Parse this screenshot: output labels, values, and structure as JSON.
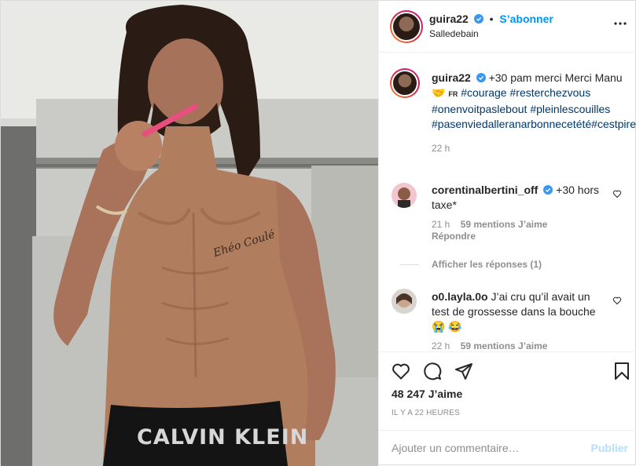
{
  "post": {
    "author": "guira22",
    "follow_label": "S’abonner",
    "location": "Salledebain",
    "separator": "•",
    "photo_brand_text": "CALVIN KLEIN",
    "photo_tattoo_text": "Ehéo Coulé"
  },
  "caption": {
    "author": "guira22",
    "text_before": "+30 pam merci Merci Manu",
    "emoji": "🤝",
    "flag": "FR",
    "hashtags": [
      "#courage",
      "#resterchezvous",
      "#onenvoitpaslebout",
      "#pleinlescouilles",
      "#pasenviedalleranarbonnecetété",
      "#cestpirequelemitarcettehistoire."
    ],
    "time": "22 h"
  },
  "comments": [
    {
      "author": "corentinalbertini_off",
      "text": "+30 hors taxe*",
      "time": "21 h",
      "likes": "59 mentions J’aime",
      "reply": "Répondre",
      "view_replies": "Afficher les réponses (1)"
    },
    {
      "author": "o0.layla.0o",
      "text": "J’ai cru qu’il avait un test de grossesse dans la bouche",
      "emojis": "😭 😂",
      "time": "22 h",
      "likes": "59 mentions J’aime"
    }
  ],
  "actions": {
    "likes": "48 247 J’aime",
    "timestamp": "IL Y A 22 HEURES"
  },
  "comment_box": {
    "placeholder": "Ajouter un commentaire…",
    "publish": "Publier"
  },
  "colors": {
    "link_blue": "#0095f6",
    "hashtag": "#00376b",
    "secondary": "#8e8e8e",
    "publish_disabled": "#b2dffc"
  }
}
